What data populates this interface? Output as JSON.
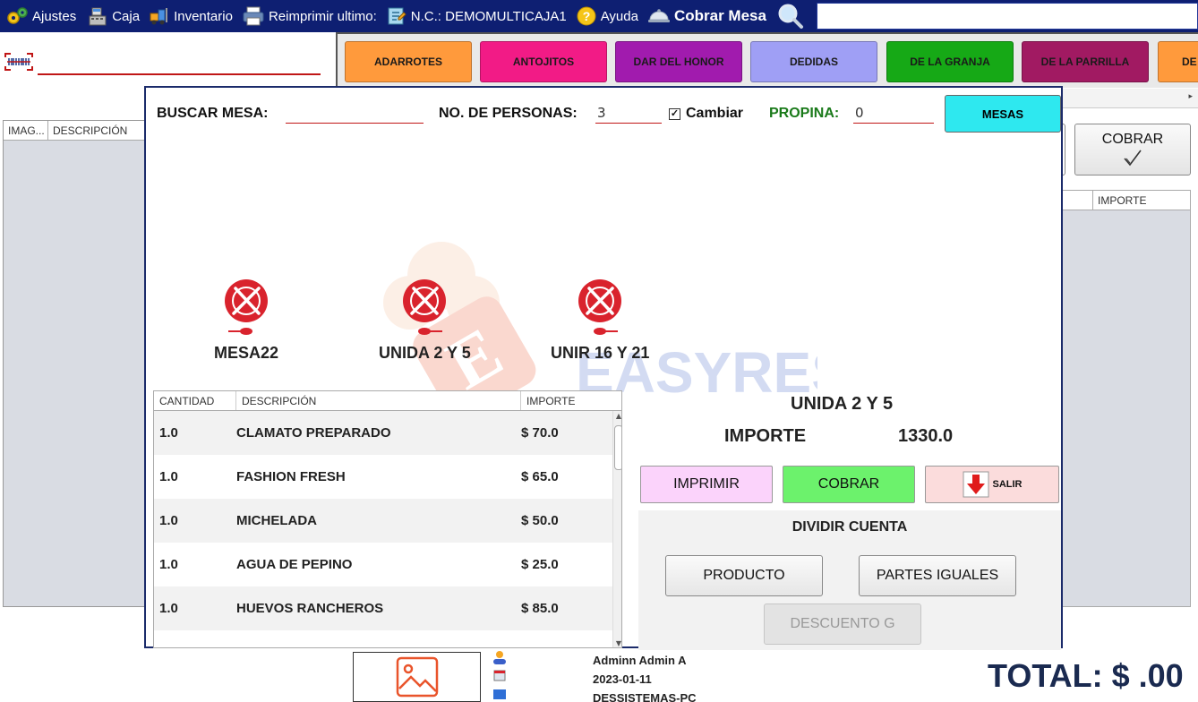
{
  "topbar": {
    "ajustes": "Ajustes",
    "caja": "Caja",
    "inventario": "Inventario",
    "reimprimir": "Reimprimir ultimo:",
    "nc": "N.C.: DEMOMULTICAJA1",
    "ayuda": "Ayuda",
    "cobrar_mesa": "Cobrar Mesa"
  },
  "categories": [
    {
      "label": "ADARROTES",
      "color": "#ff9a3c",
      "text": "#1a1a1a"
    },
    {
      "label": "ANTOJITOS",
      "color": "#f21b86",
      "text": "#1a1a1a"
    },
    {
      "label": "DAR DEL HONOR",
      "color": "#a11bae",
      "text": "#1a1a1a"
    },
    {
      "label": "DEDIDAS",
      "color": "#9f9ff5",
      "text": "#1a1a1a"
    },
    {
      "label": "DE LA GRANJA",
      "color": "#16a916",
      "text": "#1a1a1a"
    },
    {
      "label": "DE LA PARRILLA",
      "color": "#a11a62",
      "text": "#1a1a1a"
    },
    {
      "label": "DE",
      "color": "#ff9a3c",
      "text": "#1a1a1a"
    }
  ],
  "left_table": {
    "col1": "IMAG...",
    "col2": "DESCRIPCIÓN"
  },
  "right_panel": {
    "cobrar_label": "COBRAR",
    "cobrar_icon": "check-icon",
    "col_importe": "IMPORTE"
  },
  "dialog": {
    "buscar_label": "BUSCAR MESA:",
    "buscar_value": "",
    "personas_label": "NO. DE PERSONAS:",
    "personas_value": "3",
    "cambiar_label": "Cambiar",
    "cambiar_checked": true,
    "propina_label": "PROPINA:",
    "propina_value": "0",
    "mesas_button": "MESAS",
    "watermark_text": "EASYREST",
    "tables": [
      {
        "name": "MESA22"
      },
      {
        "name": "UNIDA 2 Y 5"
      },
      {
        "name": "UNIR 16 Y 21"
      }
    ],
    "orders": {
      "columns": [
        "CANTIDAD",
        "DESCRIPCIÓN",
        "IMPORTE"
      ],
      "rows": [
        {
          "qty": "1.0",
          "desc": "CLAMATO PREPARADO",
          "amount": "$ 70.0"
        },
        {
          "qty": "1.0",
          "desc": "FASHION FRESH",
          "amount": "$ 65.0"
        },
        {
          "qty": "1.0",
          "desc": "MICHELADA",
          "amount": "$ 50.0"
        },
        {
          "qty": "1.0",
          "desc": "AGUA DE PEPINO",
          "amount": "$ 25.0"
        },
        {
          "qty": "1.0",
          "desc": "HUEVOS RANCHEROS",
          "amount": "$ 85.0"
        }
      ]
    },
    "selected_mesa": "UNIDA 2 Y 5",
    "importe_label": "IMPORTE",
    "importe_value": "1330.0",
    "imprimir": "IMPRIMIR",
    "cobrar": "COBRAR",
    "salir": "SALIR",
    "dividir_title": "DIVIDIR CUENTA",
    "producto": "PRODUCTO",
    "partes_iguales": "PARTES IGUALES",
    "descuento": "DESCUENTO G"
  },
  "footer": {
    "user": "Adminn Admin A",
    "date": "2023-01-11",
    "host": "DESSISTEMAS-PC",
    "total": "TOTAL: $ .00"
  },
  "colors": {
    "topbar": "#0e1f72",
    "accent_red": "#c01616",
    "mesas_cyan": "#2ee8ef",
    "cobrar_green": "#6cf26c",
    "imprimir_pink": "#fbd3fb",
    "salir_pink": "#fbdcdc"
  }
}
